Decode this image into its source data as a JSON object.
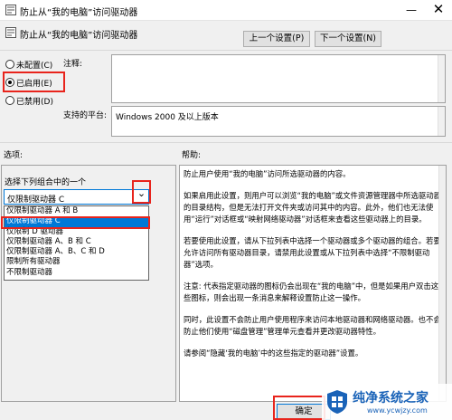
{
  "window": {
    "title": "防止从“我的电脑”访问驱动器",
    "minimize_glyph": "—",
    "close_glyph": "✕"
  },
  "header": {
    "policy_title": "防止从“我的电脑”访问驱动器",
    "prev_button": "上一个设置(P)",
    "next_button": "下一个设置(N)"
  },
  "state": {
    "options": [
      {
        "label": "未配置(C)",
        "selected": false
      },
      {
        "label": "已启用(E)",
        "selected": true
      },
      {
        "label": "已禁用(D)",
        "selected": false
      }
    ]
  },
  "comment": {
    "label": "注释:",
    "value": ""
  },
  "platform": {
    "label": "支持的平台:",
    "value": "Windows 2000 及以上版本"
  },
  "options_section": {
    "label": "选项:",
    "group_label": "选择下列组合中的一个",
    "combo_value": "仅限制驱动器 C",
    "arrow_glyph": "⌄",
    "dropdown_items": [
      {
        "label": "仅限制驱动器 A 和 B",
        "selected": false
      },
      {
        "label": "仅限制驱动器 C",
        "selected": true
      },
      {
        "label": "仅限制 D 驱动器",
        "selected": false
      },
      {
        "label": "仅限制驱动器 A、B 和 C",
        "selected": false
      },
      {
        "label": "仅限制驱动器 A、B、C 和 D",
        "selected": false
      },
      {
        "label": "限制所有驱动器",
        "selected": false
      },
      {
        "label": "不限制驱动器",
        "selected": false
      }
    ]
  },
  "help_section": {
    "label": "帮助:",
    "paragraphs": [
      "防止用户使用“我的电脑”访问所选驱动器的内容。",
      "如果启用此设置，则用户可以浏览“我的电脑”或文件资源管理器中所选驱动器的目录结构，但是无法打开文件夹或访问其中的内容。此外，他们也无法使用“运行”对话框或“映射网络驱动器”对话框来查看这些驱动器上的目录。",
      "若要使用此设置，请从下拉列表中选择一个驱动器或多个驱动器的组合。若要允许访问所有驱动器目录，请禁用此设置或从下拉列表中选择“不限制驱动器”选项。",
      "注意: 代表指定驱动器的图标仍会出现在“我的电脑”中，但是如果用户双击这些图标，则会出现一条消息来解释设置防止这一操作。",
      "同时，此设置不会防止用户使用程序来访问本地驱动器和网络驱动器。也不会防止他们使用“磁盘管理”管理单元查看并更改驱动器特性。",
      "请参阅“隐藏‘我的电脑’中的这些指定的驱动器”设置。"
    ]
  },
  "footer": {
    "ok_button": "确定"
  },
  "watermark": {
    "brand": "纯净系统之家",
    "url": "www.ycwjzy.com"
  },
  "colors": {
    "highlight_red": "#e8241c",
    "selection_blue": "#0078d7",
    "watermark_blue": "#1a63b8"
  }
}
